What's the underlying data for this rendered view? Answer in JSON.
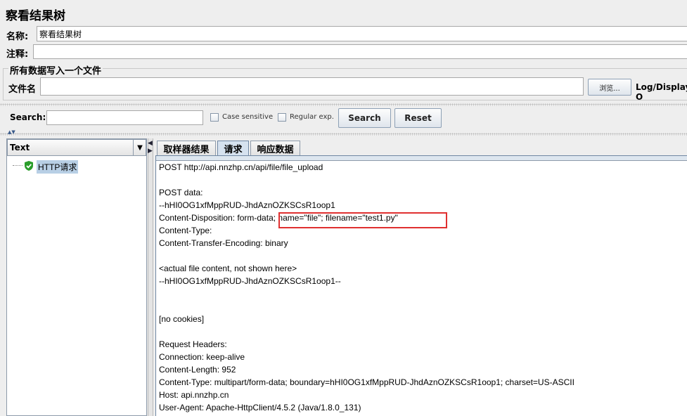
{
  "window": {
    "title": "察看结果树"
  },
  "form": {
    "name_label": "名称:",
    "name_value": "察看结果树",
    "comment_label": "注释:",
    "comment_value": "",
    "file_group_label": "所有数据写入一个文件",
    "filename_label": "文件名",
    "filename_value": "",
    "browse_label": "浏览...",
    "log_display_label": "Log/Display O"
  },
  "search": {
    "label": "Search:",
    "value": "",
    "case_sensitive_label": "Case sensitive",
    "regex_label": "Regular exp.",
    "search_button": "Search",
    "reset_button": "Reset"
  },
  "tree": {
    "renderer_select": "Text",
    "items": [
      {
        "label": "HTTP请求",
        "status": "success"
      }
    ]
  },
  "tabs": [
    {
      "label": "取样器结果",
      "active": false
    },
    {
      "label": "请求",
      "active": true
    },
    {
      "label": "响应数据",
      "active": false
    }
  ],
  "request_lines": [
    "POST http://api.nnzhp.cn/api/file/file_upload",
    "",
    "POST data:",
    "--hHI0OG1xfMppRUD-JhdAznOZKSCsR1oop1",
    "Content-Disposition: form-data; name=\"file\"; filename=\"test1.py\"",
    "Content-Type:",
    "Content-Transfer-Encoding: binary",
    "",
    "<actual file content, not shown here>",
    "--hHI0OG1xfMppRUD-JhdAznOZKSCsR1oop1--",
    "",
    "",
    "[no cookies]",
    "",
    "Request Headers:",
    "Connection: keep-alive",
    "Content-Length: 952",
    "Content-Type: multipart/form-data; boundary=hHI0OG1xfMppRUD-JhdAznOZKSCsR1oop1; charset=US-ASCII",
    "Host: api.nnzhp.cn",
    "User-Agent: Apache-HttpClient/4.5.2 (Java/1.8.0_131)"
  ],
  "colors": {
    "highlight_box": "#e03030",
    "tree_selection": "#b8cfe5",
    "success_icon": "#2a9d2a"
  }
}
